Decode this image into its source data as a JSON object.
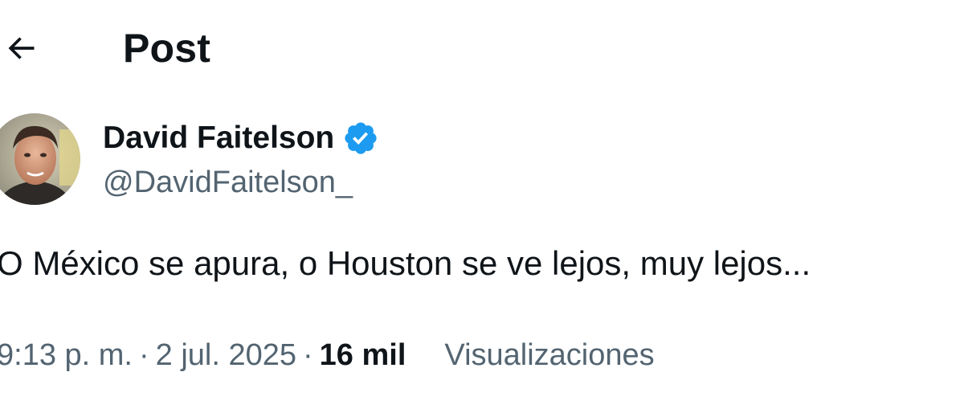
{
  "header": {
    "title": "Post",
    "back_icon": "arrow-left-icon"
  },
  "author": {
    "display_name": "David Faitelson",
    "handle": "@DavidFaitelson_",
    "verified_icon": "verified-badge-icon",
    "verified_color": "#1d9bf0"
  },
  "post": {
    "text": "O México se apura, o Houston se ve lejos, muy lejos..."
  },
  "meta": {
    "time": "9:13 p. m.",
    "separator": "·",
    "date": "2 jul. 2025",
    "separator2": "·",
    "views_count": "16 mil",
    "views_label": "Visualizaciones"
  },
  "colors": {
    "text_primary": "#0f1419",
    "text_secondary": "#536471",
    "background": "#ffffff"
  }
}
